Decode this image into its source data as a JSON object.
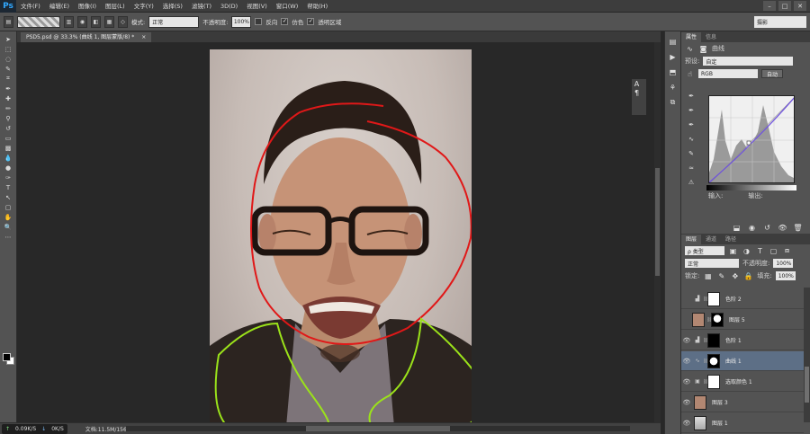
{
  "app": {
    "logo": "Ps"
  },
  "menu": [
    "文件(F)",
    "编辑(E)",
    "图像(I)",
    "图层(L)",
    "文字(Y)",
    "选择(S)",
    "滤镜(T)",
    "3D(D)",
    "视图(V)",
    "窗口(W)",
    "帮助(H)"
  ],
  "options": {
    "mode_label": "模式:",
    "mode_value": "正常",
    "opacity_label": "不透明度:",
    "opacity_value": "100%",
    "reverse_label": "反向",
    "dither_label": "仿色",
    "transparency_label": "透明区域",
    "workspace": "摄影"
  },
  "document": {
    "tab_title": "PSD5.psd @ 33.3% (曲线 1, 图层蒙版/8) *",
    "tab_close": "×"
  },
  "status": {
    "upload": "0.09K/S",
    "download": "0K/S",
    "doc_info": "文档:11.5M/156.4M"
  },
  "properties_panel": {
    "tabs": [
      "属性",
      "信息"
    ],
    "title": "曲线",
    "preset_label": "预设:",
    "preset_value": "自定",
    "channel_value": "RGB",
    "auto_button": "自动",
    "input_label": "输入:",
    "output_label": "输出:"
  },
  "layers_panel": {
    "tabs": [
      "图层",
      "通道",
      "路径"
    ],
    "filter_value": "ρ 类型",
    "blend_mode": "正常",
    "opacity_label": "不透明度:",
    "opacity_value": "100%",
    "lock_label": "锁定:",
    "fill_label": "填充:",
    "fill_value": "100%",
    "layers": [
      {
        "name": "色阶 2",
        "type": "adjustment",
        "visible": false
      },
      {
        "name": "图层 5",
        "type": "photo-masked",
        "visible": false
      },
      {
        "name": "色阶 1",
        "type": "adjustment",
        "visible": true
      },
      {
        "name": "曲线 1",
        "type": "curves",
        "visible": true,
        "selected": true
      },
      {
        "name": "选取颜色 1",
        "type": "adjustment",
        "visible": true
      },
      {
        "name": "图层 3",
        "type": "photo",
        "visible": true
      },
      {
        "name": "图层 1",
        "type": "photo",
        "visible": true
      }
    ]
  },
  "colors": {
    "accent_red": "#e01818",
    "accent_green": "#9be21a",
    "selection": "#5d6f86"
  }
}
